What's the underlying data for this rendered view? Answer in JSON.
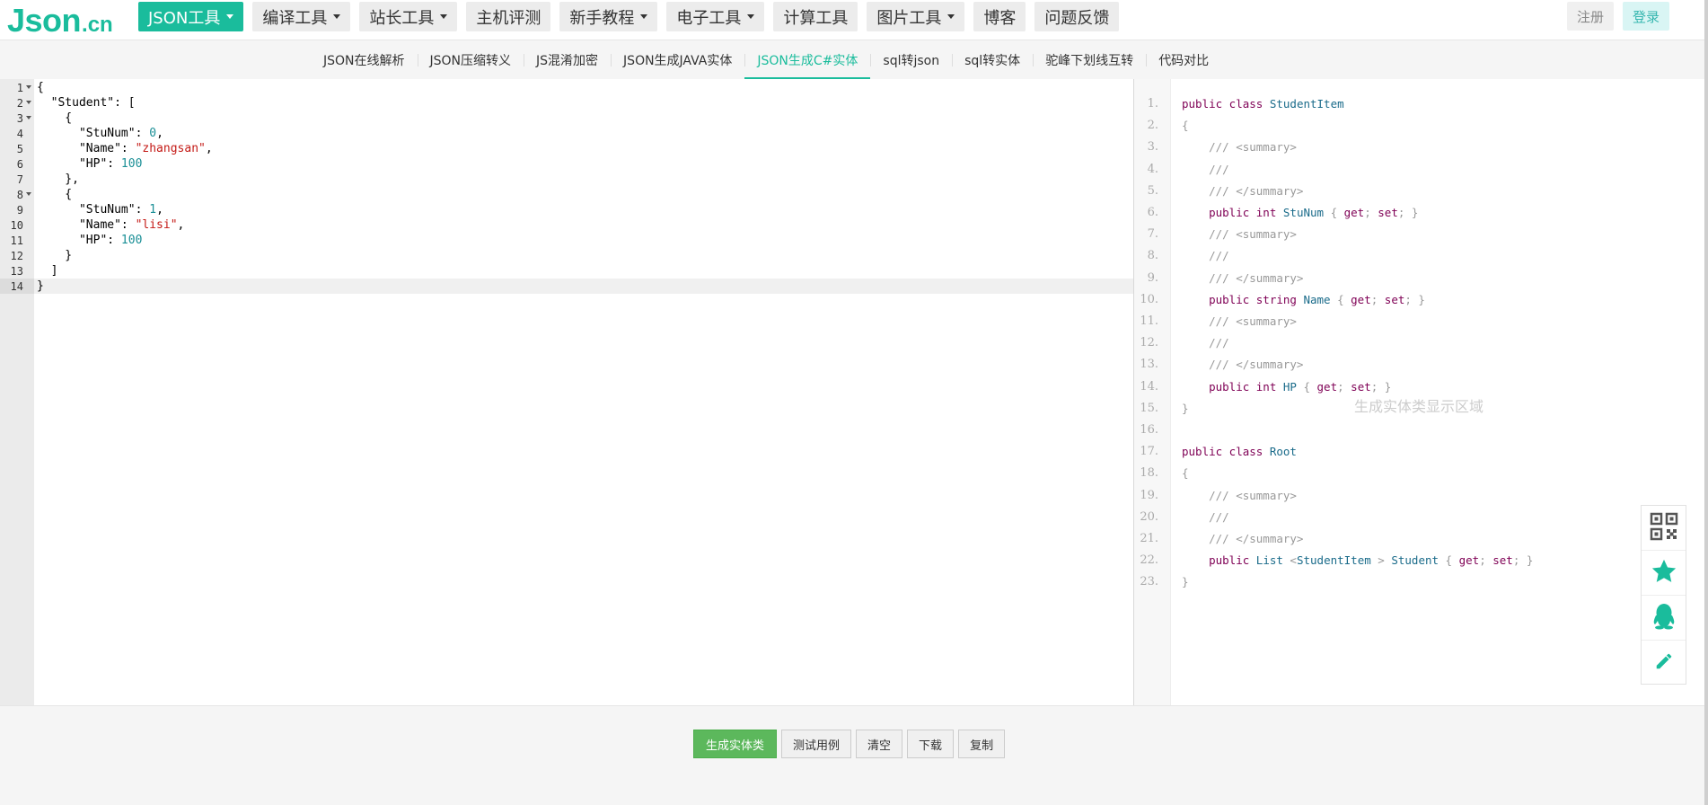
{
  "logo": {
    "main": "Json",
    "suffix": ".cn"
  },
  "menu": [
    {
      "label": "JSON工具",
      "dropdown": true,
      "active": true
    },
    {
      "label": "编译工具",
      "dropdown": true
    },
    {
      "label": "站长工具",
      "dropdown": true
    },
    {
      "label": "主机评测",
      "dropdown": false
    },
    {
      "label": "新手教程",
      "dropdown": true
    },
    {
      "label": "电子工具",
      "dropdown": true
    },
    {
      "label": "计算工具",
      "dropdown": false
    },
    {
      "label": "图片工具",
      "dropdown": true
    },
    {
      "label": "博客",
      "dropdown": false
    },
    {
      "label": "问题反馈",
      "dropdown": false
    }
  ],
  "auth": {
    "register": "注册",
    "login": "登录"
  },
  "tabs": [
    {
      "label": "JSON在线解析"
    },
    {
      "label": "JSON压缩转义"
    },
    {
      "label": "JS混淆加密"
    },
    {
      "label": "JSON生成JAVA实体"
    },
    {
      "label": "JSON生成C#实体",
      "active": true
    },
    {
      "label": "sql转json"
    },
    {
      "label": "sql转实体"
    },
    {
      "label": "驼峰下划线互转"
    },
    {
      "label": "代码对比"
    }
  ],
  "input_lines": [
    {
      "n": "1",
      "fold": true,
      "parts": [
        [
          "p",
          "{"
        ]
      ]
    },
    {
      "n": "2",
      "fold": true,
      "parts": [
        [
          "p",
          "  \"Student\": ["
        ]
      ]
    },
    {
      "n": "3",
      "fold": true,
      "parts": [
        [
          "p",
          "    {"
        ]
      ]
    },
    {
      "n": "4",
      "parts": [
        [
          "p",
          "      \"StuNum\": "
        ],
        [
          "num",
          "0"
        ],
        [
          "p",
          ","
        ]
      ]
    },
    {
      "n": "5",
      "parts": [
        [
          "p",
          "      \"Name\": "
        ],
        [
          "str",
          "\"zhangsan\""
        ],
        [
          "p",
          ","
        ]
      ]
    },
    {
      "n": "6",
      "parts": [
        [
          "p",
          "      \"HP\": "
        ],
        [
          "num",
          "100"
        ]
      ]
    },
    {
      "n": "7",
      "parts": [
        [
          "p",
          "    },"
        ]
      ]
    },
    {
      "n": "8",
      "fold": true,
      "parts": [
        [
          "p",
          "    {"
        ]
      ]
    },
    {
      "n": "9",
      "parts": [
        [
          "p",
          "      \"StuNum\": "
        ],
        [
          "num",
          "1"
        ],
        [
          "p",
          ","
        ]
      ]
    },
    {
      "n": "10",
      "parts": [
        [
          "p",
          "      \"Name\": "
        ],
        [
          "str",
          "\"lisi\""
        ],
        [
          "p",
          ","
        ]
      ]
    },
    {
      "n": "11",
      "parts": [
        [
          "p",
          "      \"HP\": "
        ],
        [
          "num",
          "100"
        ]
      ]
    },
    {
      "n": "12",
      "parts": [
        [
          "p",
          "    }"
        ]
      ]
    },
    {
      "n": "13",
      "parts": [
        [
          "p",
          "  ]"
        ]
      ]
    },
    {
      "n": "14",
      "hl": true,
      "parts": [
        [
          "p",
          "}"
        ]
      ]
    }
  ],
  "output_lines": [
    {
      "n": "1.",
      "parts": [
        [
          "kw",
          "public class "
        ],
        [
          "ty",
          "StudentItem"
        ]
      ]
    },
    {
      "n": "2.",
      "parts": [
        [
          "pn",
          "{"
        ]
      ]
    },
    {
      "n": "3.",
      "parts": [
        [
          "cm",
          "    /// <summary>"
        ]
      ]
    },
    {
      "n": "4.",
      "parts": [
        [
          "cm",
          "    ///"
        ]
      ]
    },
    {
      "n": "5.",
      "parts": [
        [
          "cm",
          "    /// </summary>"
        ]
      ]
    },
    {
      "n": "6.",
      "parts": [
        [
          "kw",
          "    public int "
        ],
        [
          "ty",
          "StuNum"
        ],
        [
          "pn",
          " { "
        ],
        [
          "kw",
          "get"
        ],
        [
          "pn",
          "; "
        ],
        [
          "kw",
          "set"
        ],
        [
          "pn",
          "; }"
        ]
      ]
    },
    {
      "n": "7.",
      "parts": [
        [
          "cm",
          "    /// <summary>"
        ]
      ]
    },
    {
      "n": "8.",
      "parts": [
        [
          "cm",
          "    ///"
        ]
      ]
    },
    {
      "n": "9.",
      "parts": [
        [
          "cm",
          "    /// </summary>"
        ]
      ]
    },
    {
      "n": "10.",
      "parts": [
        [
          "kw",
          "    public string "
        ],
        [
          "ty",
          "Name"
        ],
        [
          "pn",
          " { "
        ],
        [
          "kw",
          "get"
        ],
        [
          "pn",
          "; "
        ],
        [
          "kw",
          "set"
        ],
        [
          "pn",
          "; }"
        ]
      ]
    },
    {
      "n": "11.",
      "parts": [
        [
          "cm",
          "    /// <summary>"
        ]
      ]
    },
    {
      "n": "12.",
      "parts": [
        [
          "cm",
          "    ///"
        ]
      ]
    },
    {
      "n": "13.",
      "parts": [
        [
          "cm",
          "    /// </summary>"
        ]
      ]
    },
    {
      "n": "14.",
      "parts": [
        [
          "kw",
          "    public int "
        ],
        [
          "ty",
          "HP"
        ],
        [
          "pn",
          " { "
        ],
        [
          "kw",
          "get"
        ],
        [
          "pn",
          "; "
        ],
        [
          "kw",
          "set"
        ],
        [
          "pn",
          "; }"
        ]
      ]
    },
    {
      "n": "15.",
      "parts": [
        [
          "pn",
          "}"
        ]
      ]
    },
    {
      "n": "16.",
      "parts": []
    },
    {
      "n": "17.",
      "parts": [
        [
          "kw",
          "public class "
        ],
        [
          "ty",
          "Root"
        ]
      ]
    },
    {
      "n": "18.",
      "parts": [
        [
          "pn",
          "{"
        ]
      ]
    },
    {
      "n": "19.",
      "parts": [
        [
          "cm",
          "    /// <summary>"
        ]
      ]
    },
    {
      "n": "20.",
      "parts": [
        [
          "cm",
          "    ///"
        ]
      ]
    },
    {
      "n": "21.",
      "parts": [
        [
          "cm",
          "    /// </summary>"
        ]
      ]
    },
    {
      "n": "22.",
      "parts": [
        [
          "kw",
          "    public "
        ],
        [
          "ty",
          "List"
        ],
        [
          "pn",
          " <"
        ],
        [
          "ty",
          "StudentItem"
        ],
        [
          "pn",
          " > "
        ],
        [
          "ty",
          "Student"
        ],
        [
          "pn",
          " { "
        ],
        [
          "kw",
          "get"
        ],
        [
          "pn",
          "; "
        ],
        [
          "kw",
          "set"
        ],
        [
          "pn",
          "; }"
        ]
      ]
    },
    {
      "n": "23.",
      "parts": [
        [
          "pn",
          "}"
        ]
      ]
    }
  ],
  "output_placeholder": "生成实体类显示区域",
  "float_bar": [
    {
      "icon": "qrcode-icon"
    },
    {
      "icon": "star-icon"
    },
    {
      "icon": "qq-icon"
    },
    {
      "icon": "pencil-icon"
    }
  ],
  "buttons": {
    "generate": "生成实体类",
    "test": "测试用例",
    "clear": "清空",
    "download": "下载",
    "copy": "复制"
  },
  "colors": {
    "accent": "#1abc9c",
    "primary_button": "#5cb85c"
  }
}
